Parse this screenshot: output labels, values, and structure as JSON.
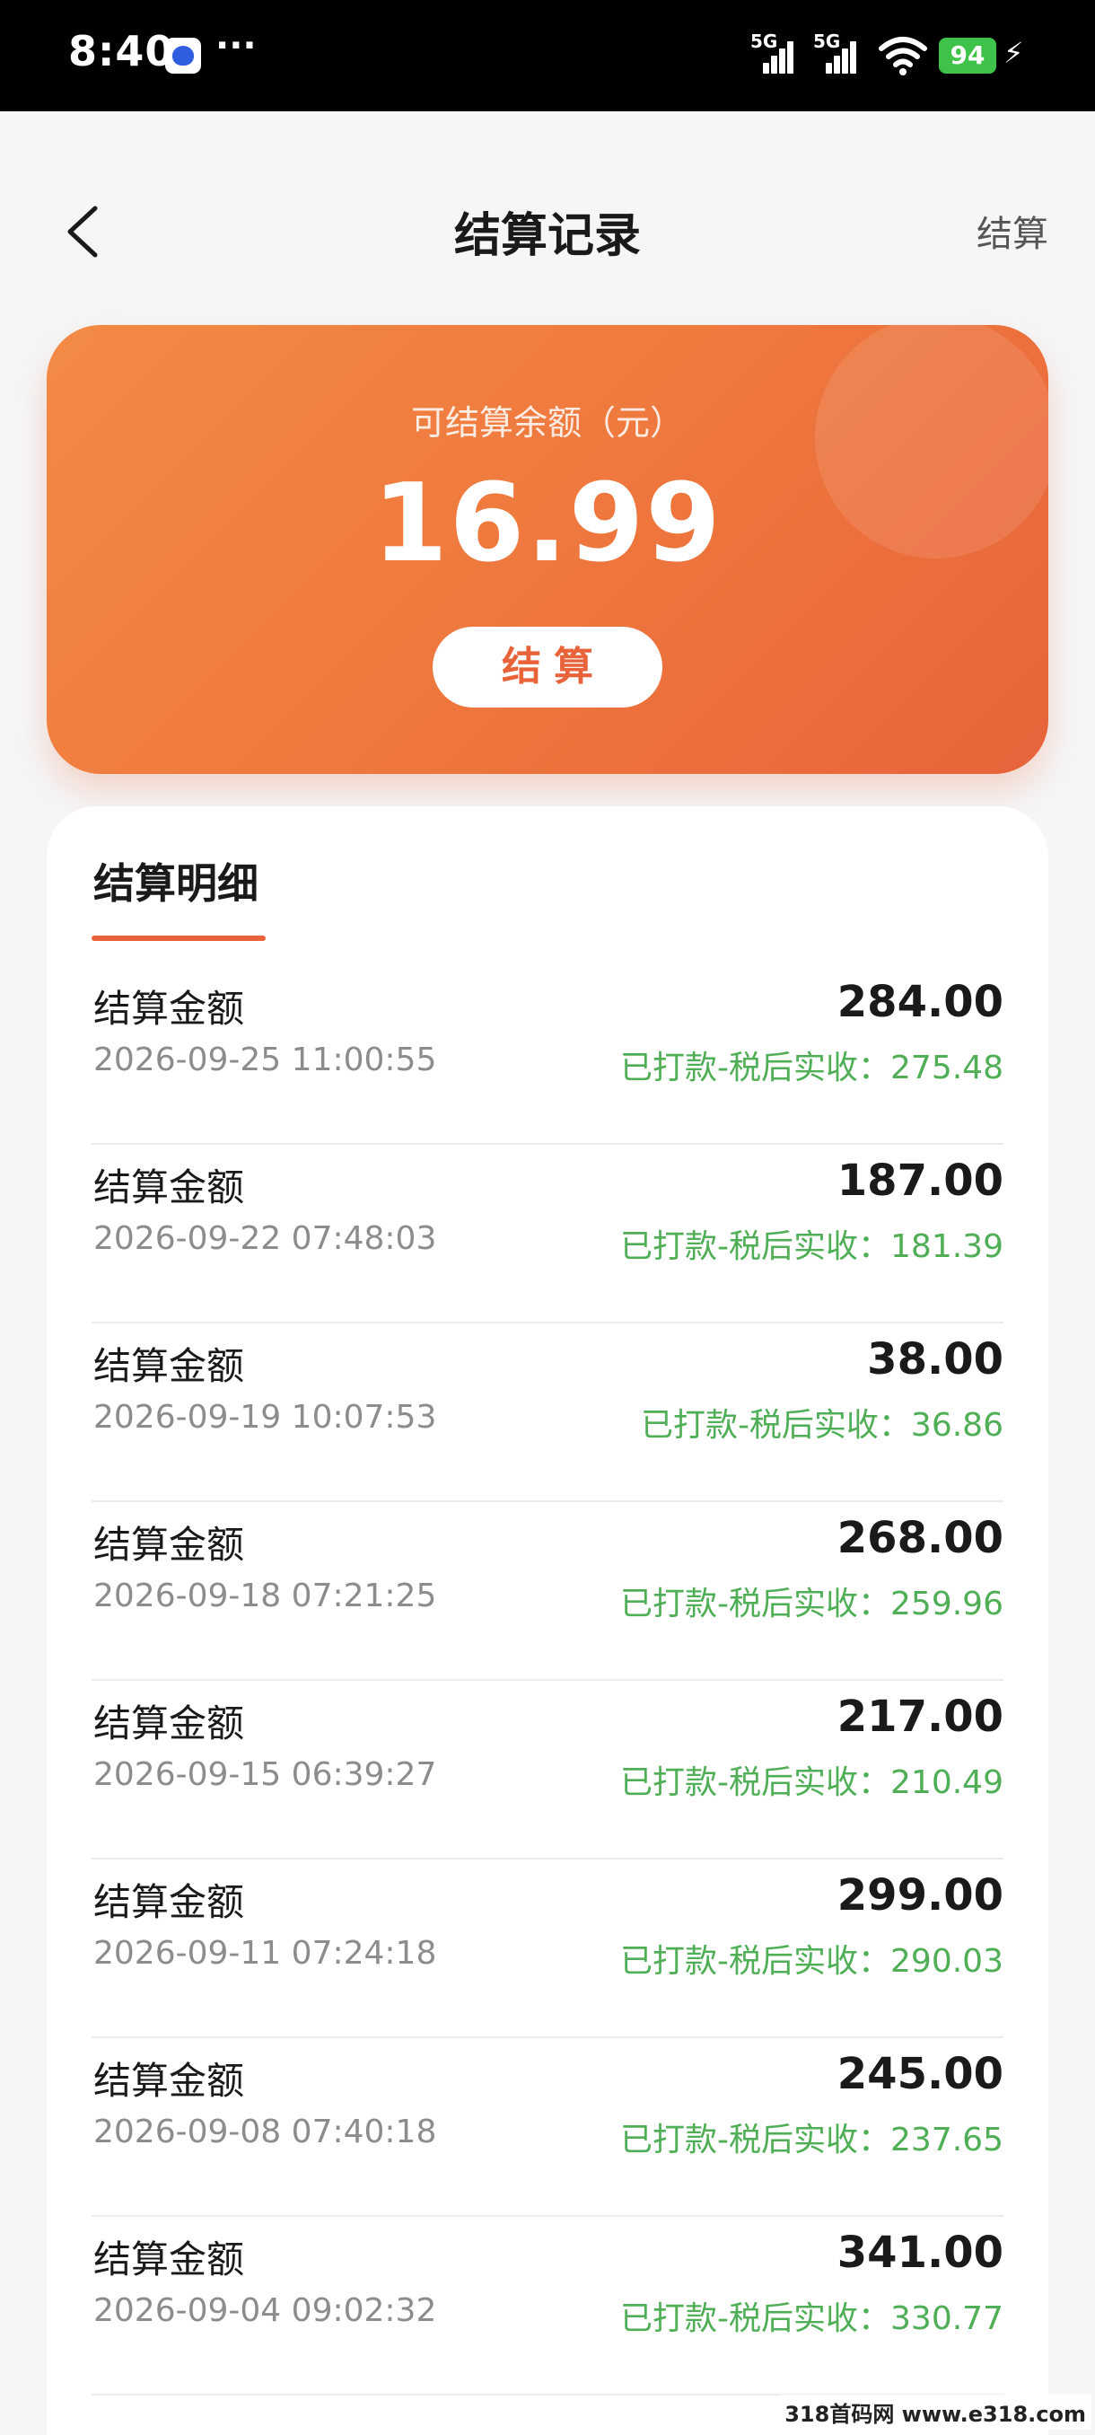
{
  "status_bar": {
    "time": "8:40",
    "more": "···",
    "signal_1_label": "5G",
    "signal_2_label": "5G",
    "battery": "94",
    "charging_icon": "bolt-icon"
  },
  "nav": {
    "title": "结算记录",
    "action": "结算",
    "back_icon": "chevron-left-icon"
  },
  "balance": {
    "label": "可结算余额（元）",
    "value": "16.99",
    "button": "结算"
  },
  "details": {
    "title": "结算明细",
    "records": [
      {
        "label": "结算金额",
        "time": "2026-09-25 11:00:55",
        "amount": "284.00",
        "status": "已打款-税后实收：275.48"
      },
      {
        "label": "结算金额",
        "time": "2026-09-22 07:48:03",
        "amount": "187.00",
        "status": "已打款-税后实收：181.39"
      },
      {
        "label": "结算金额",
        "time": "2026-09-19 10:07:53",
        "amount": "38.00",
        "status": "已打款-税后实收：36.86"
      },
      {
        "label": "结算金额",
        "time": "2026-09-18 07:21:25",
        "amount": "268.00",
        "status": "已打款-税后实收：259.96"
      },
      {
        "label": "结算金额",
        "time": "2026-09-15 06:39:27",
        "amount": "217.00",
        "status": "已打款-税后实收：210.49"
      },
      {
        "label": "结算金额",
        "time": "2026-09-11 07:24:18",
        "amount": "299.00",
        "status": "已打款-税后实收：290.03"
      },
      {
        "label": "结算金额",
        "time": "2026-09-08 07:40:18",
        "amount": "245.00",
        "status": "已打款-税后实收：237.65"
      },
      {
        "label": "结算金额",
        "time": "2026-09-04 09:02:32",
        "amount": "341.00",
        "status": "已打款-税后实收：330.77"
      }
    ]
  },
  "colors": {
    "accent": "#e8633a",
    "success": "#4fae56"
  },
  "watermark": "318首码网 www.e318.com"
}
